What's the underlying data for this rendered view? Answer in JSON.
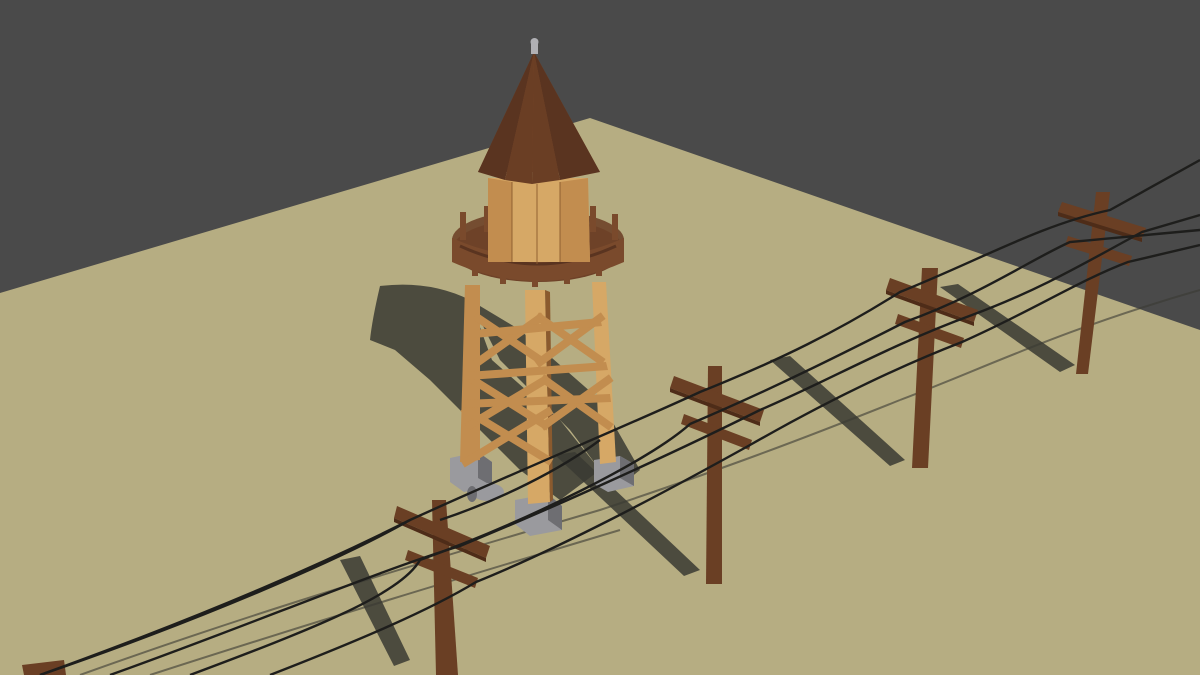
{
  "scene": {
    "objects": [
      "water-tower",
      "utility-pole",
      "utility-pole",
      "utility-pole",
      "utility-pole",
      "power-line"
    ],
    "colors": {
      "background": "#4a4a4a",
      "ground": "#b6ad82",
      "ground_shadow": "#3a3a33",
      "wood_light": "#d6a866",
      "wood_mid": "#c28d4f",
      "wood_dark": "#8a5a2e",
      "roof": "#7a4a2c",
      "roof_dark": "#5a3420",
      "deck": "#6e4228",
      "pole": "#6a3f24",
      "pole_dark": "#4e2c18",
      "concrete": "#9a9a9e",
      "concrete_dark": "#6e6e72",
      "wire": "#1e1e1c",
      "finial": "#b0b0b4"
    }
  }
}
